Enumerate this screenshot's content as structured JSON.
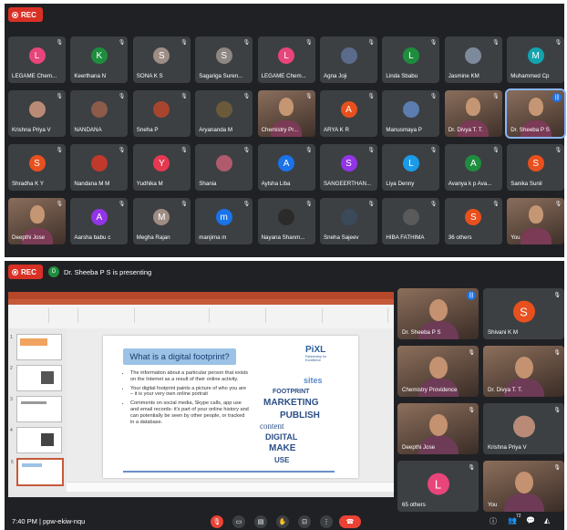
{
  "grid": {
    "rec_label": "REC",
    "tiles": [
      {
        "name": "LEGAME Chem...",
        "initial": "L",
        "color": "#e8457b",
        "kind": "avatar"
      },
      {
        "name": "Keerthana N",
        "initial": "K",
        "color": "#1e8e3e",
        "kind": "avatar"
      },
      {
        "name": "SONA K S",
        "initial": "S",
        "color": "#9e8d85",
        "kind": "avatar"
      },
      {
        "name": "Sagariga Suren...",
        "initial": "S",
        "color": "#8d8682",
        "kind": "avatar"
      },
      {
        "name": "LEGAME Chem...",
        "initial": "L",
        "color": "#e8457b",
        "kind": "avatar"
      },
      {
        "name": "Agna Joji",
        "initial": "",
        "color": "#5a6b8c",
        "kind": "photo"
      },
      {
        "name": "Linda Sbabu",
        "initial": "L",
        "color": "#1e8e3e",
        "kind": "avatar"
      },
      {
        "name": "Jasmine KM",
        "initial": "",
        "color": "#7d8a9b",
        "kind": "photo"
      },
      {
        "name": "Muhammed Cp",
        "initial": "M",
        "color": "#12a4af",
        "kind": "avatar"
      },
      {
        "name": "Krishna Priya V",
        "initial": "",
        "color": "#b98b76",
        "kind": "photo"
      },
      {
        "name": "NANDANA",
        "initial": "",
        "color": "#8c5b4a",
        "kind": "photo"
      },
      {
        "name": "Sneha P",
        "initial": "",
        "color": "#a8452f",
        "kind": "photo"
      },
      {
        "name": "Aryananda M",
        "initial": "",
        "color": "#6b5a3a",
        "kind": "photo"
      },
      {
        "name": "Chemistry Pr...",
        "initial": "",
        "color": "",
        "kind": "video"
      },
      {
        "name": "ARYA K R",
        "initial": "A",
        "color": "#e8501e",
        "kind": "avatar"
      },
      {
        "name": "Manusmaya P",
        "initial": "",
        "color": "#5b7db0",
        "kind": "photo"
      },
      {
        "name": "Dr. Divya T. T.",
        "initial": "",
        "color": "",
        "kind": "video"
      },
      {
        "name": "Dr. Sheeba P S",
        "initial": "",
        "color": "",
        "kind": "video-active"
      },
      {
        "name": "Shradha K Y",
        "initial": "S",
        "color": "#e8501e",
        "kind": "avatar"
      },
      {
        "name": "Nandana M M",
        "initial": "",
        "color": "#c0392b",
        "kind": "photo"
      },
      {
        "name": "Yudhika M",
        "initial": "Y",
        "color": "#e53950",
        "kind": "avatar"
      },
      {
        "name": "Shania",
        "initial": "",
        "color": "#b05a6e",
        "kind": "photo"
      },
      {
        "name": "Aylsha Liba",
        "initial": "A",
        "color": "#1a73e8",
        "kind": "avatar"
      },
      {
        "name": "SANGEERTHAN...",
        "initial": "S",
        "color": "#9334e6",
        "kind": "avatar"
      },
      {
        "name": "Liya Denny",
        "initial": "L",
        "color": "#1a9be8",
        "kind": "avatar"
      },
      {
        "name": "Avanya k p Ava...",
        "initial": "A",
        "color": "#1e8e3e",
        "kind": "avatar"
      },
      {
        "name": "Sanika Sunil",
        "initial": "S",
        "color": "#e8501e",
        "kind": "avatar"
      },
      {
        "name": "Deepthi Jose",
        "initial": "",
        "color": "",
        "kind": "video"
      },
      {
        "name": "Aarsha babu c",
        "initial": "A",
        "color": "#9334e6",
        "kind": "avatar"
      },
      {
        "name": "Megha Rajan",
        "initial": "M",
        "color": "#9e8d85",
        "kind": "avatar"
      },
      {
        "name": "manjima m",
        "initial": "m",
        "color": "#1a73e8",
        "kind": "avatar"
      },
      {
        "name": "Nayana Shanm...",
        "initial": "",
        "color": "#2b2b2b",
        "kind": "photo"
      },
      {
        "name": "Sneha Sajeev",
        "initial": "",
        "color": "#3a4a5a",
        "kind": "photo"
      },
      {
        "name": "HIBA FATHIMA",
        "initial": "",
        "color": "#5a5a5a",
        "kind": "photo"
      },
      {
        "name": "36 others",
        "initial": "S",
        "color": "#e8501e",
        "kind": "others"
      },
      {
        "name": "You",
        "initial": "",
        "color": "",
        "kind": "video"
      }
    ]
  },
  "present": {
    "rec_label": "REC",
    "presenting_initial": "D",
    "presenting_text": "Dr. Sheeba P S is presenting",
    "slide": {
      "title": "What is a digital footprint?",
      "logo_big": "PiXL",
      "logo_small": "Partnership for Excellence",
      "bullets": [
        "The information about a particular person that exists on the Internet as a result of their online activity.",
        "Your digital footprint paints a picture of who you are – it is your very own online portrait",
        "Comments on social media, Skype calls, app use and email records- it's part of your online history and can potentially be seen by other people, or tracked in a database."
      ],
      "cloud_words": [
        "FOOTPRINT",
        "MARKETING",
        "PUBLISH",
        "content",
        "DIGITAL",
        "MAKE",
        "USE",
        "sites"
      ]
    },
    "side_tiles": [
      {
        "name": "Dr. Sheeba P S",
        "initial": "",
        "color": "",
        "kind": "video-active"
      },
      {
        "name": "Shivani K M",
        "initial": "S",
        "color": "#e8501e",
        "kind": "avatar"
      },
      {
        "name": "Chemistry Providence",
        "initial": "",
        "color": "",
        "kind": "video"
      },
      {
        "name": "Dr. Divya T. T.",
        "initial": "",
        "color": "",
        "kind": "video"
      },
      {
        "name": "Deepthi Jose",
        "initial": "",
        "color": "",
        "kind": "video"
      },
      {
        "name": "Krishna Priya V",
        "initial": "",
        "color": "#b98b76",
        "kind": "photo"
      },
      {
        "name": "65 others",
        "initial": "L",
        "color": "#e8457b",
        "kind": "others"
      },
      {
        "name": "You",
        "initial": "",
        "color": "",
        "kind": "video"
      }
    ]
  },
  "controls": {
    "time_code": "7:40 PM | ppw-ekiw-nqu",
    "participant_count": "72"
  }
}
